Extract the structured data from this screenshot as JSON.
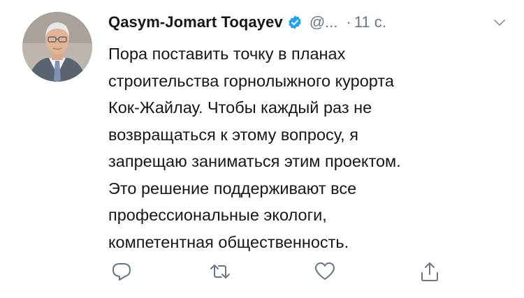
{
  "tweet": {
    "author": {
      "display_name": "Qasym-Jomart Toqayev",
      "handle": "@...",
      "verified": true
    },
    "separator": "·",
    "timestamp": "11 с.",
    "text_lines": [
      "Пора поставить точку в планах",
      "строительства горнолыжного курорта",
      "Кок-Жайлау. Чтобы каждый раз не",
      "возвращаться к этому вопросу, я",
      "запрещаю заниматься этим проектом.",
      "Это решение поддерживают все",
      "профессиональные экологи,",
      "компетентная общественность."
    ],
    "actions": [
      {
        "name": "reply",
        "icon": "reply-icon"
      },
      {
        "name": "retweet",
        "icon": "retweet-icon"
      },
      {
        "name": "like",
        "icon": "heart-icon"
      },
      {
        "name": "share",
        "icon": "share-icon"
      }
    ]
  },
  "colors": {
    "text": "#14171a",
    "secondary": "#657786",
    "verified": "#1da1f2",
    "background": "#ffffff"
  }
}
